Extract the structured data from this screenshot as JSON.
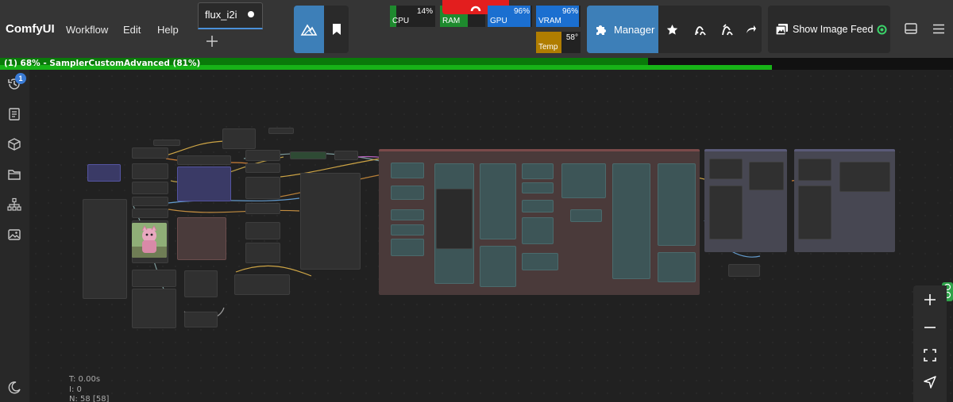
{
  "app": {
    "brand": "ComfyUI"
  },
  "menu": {
    "workflow": "Workflow",
    "edit": "Edit",
    "help": "Help"
  },
  "tabs": [
    {
      "label": "flux_i2i",
      "modified": true
    }
  ],
  "monitor": {
    "cpu": {
      "label": "CPU",
      "value": "14%",
      "percent": 14,
      "color": "#1e8a2e"
    },
    "ram": {
      "label": "RAM",
      "color": "#1e8a2e"
    },
    "gpu": {
      "label": "GPU",
      "value": "96%",
      "percent": 96,
      "color": "#1b6fd0"
    },
    "vram": {
      "label": "VRAM",
      "value": "96%",
      "percent": 96,
      "color": "#1b6fd0"
    },
    "temp": {
      "label": "Temp",
      "value": "58°",
      "percent": 58,
      "color": "#b07d00"
    }
  },
  "toolbar": {
    "manager_label": "Manager",
    "image_feed_label": "Show Image Feed"
  },
  "progress": {
    "text": "(1) 68% - SamplerCustomAdvanced (81%)",
    "total_percent": 68,
    "node_percent": 81
  },
  "queue": {
    "badge": "1"
  },
  "stats": {
    "t": "T: 0.00s",
    "i": "I: 0",
    "n": "N: 58 [58]"
  },
  "icons": {
    "history": "history-icon",
    "queue": "list-icon",
    "models": "cube-icon",
    "workflows": "folder-icon",
    "node_library": "sitemap-icon",
    "images": "image-icon",
    "theme": "moon-icon"
  }
}
